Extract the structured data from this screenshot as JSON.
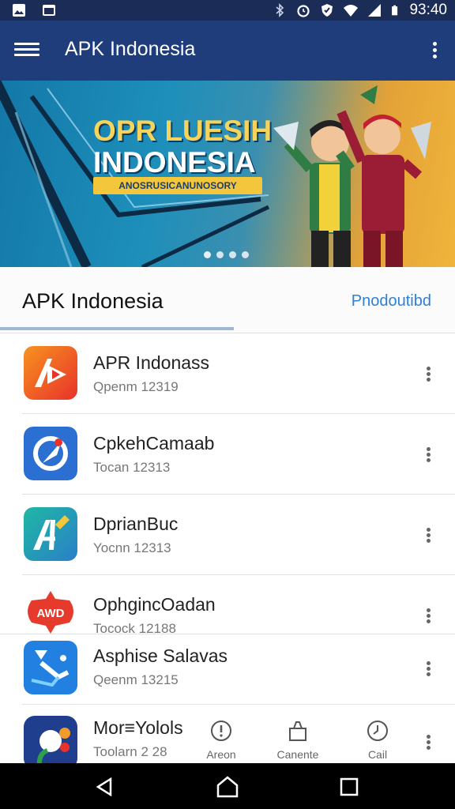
{
  "status_bar": {
    "time": "93:40",
    "left_icons": [
      "image-icon",
      "gallery-icon"
    ],
    "right_icons": [
      "bluetooth-icon",
      "alarm-icon",
      "shield-icon",
      "wifi-icon",
      "signal-icon",
      "battery-icon"
    ]
  },
  "app_bar": {
    "title": "APK Indonesia",
    "menu_icon": "hamburger-icon",
    "more_icon": "more-vertical-icon",
    "color": "#1f3d7b"
  },
  "banner": {
    "headline_line1": "OPR LUESIH",
    "headline_line2": "INDONESIA",
    "tagline": "ANOSRUSICANUNOSORY",
    "page_indicator": {
      "total": 4,
      "active": 0
    }
  },
  "section": {
    "title": "APK Indonesia",
    "link": "Pnodoutibd"
  },
  "apps": [
    {
      "name": "APR Indonass",
      "subtitle": "Qpenm 12319",
      "icon": "play-icon"
    },
    {
      "name": "CpkehCamaab",
      "subtitle": "Tocan 12313",
      "icon": "compass-icon"
    },
    {
      "name": "DprianBuc",
      "subtitle": "Yocnn 12313",
      "icon": "ai-brush-icon"
    },
    {
      "name": "OphgincOadan",
      "subtitle": "Tocock 12188",
      "icon": "awd-badge-icon"
    },
    {
      "name": "Asphise Salavas",
      "subtitle": "Qeenm 13215",
      "icon": "map-pin-icon"
    },
    {
      "name": "Mor≡Yolols",
      "subtitle": "Toolarn 2 28",
      "icon": "puzzle-icon"
    }
  ],
  "bottom_tabs": [
    {
      "label": "Areon",
      "icon": "info-icon"
    },
    {
      "label": "Canente",
      "icon": "bag-icon"
    },
    {
      "label": "Cail",
      "icon": "clock-icon"
    }
  ],
  "nav_bar": {
    "icons": [
      "back-icon",
      "home-icon",
      "recents-icon"
    ]
  },
  "colors": {
    "accent_link": "#2f7fd6",
    "tab_indicator": "#9db6d6"
  }
}
